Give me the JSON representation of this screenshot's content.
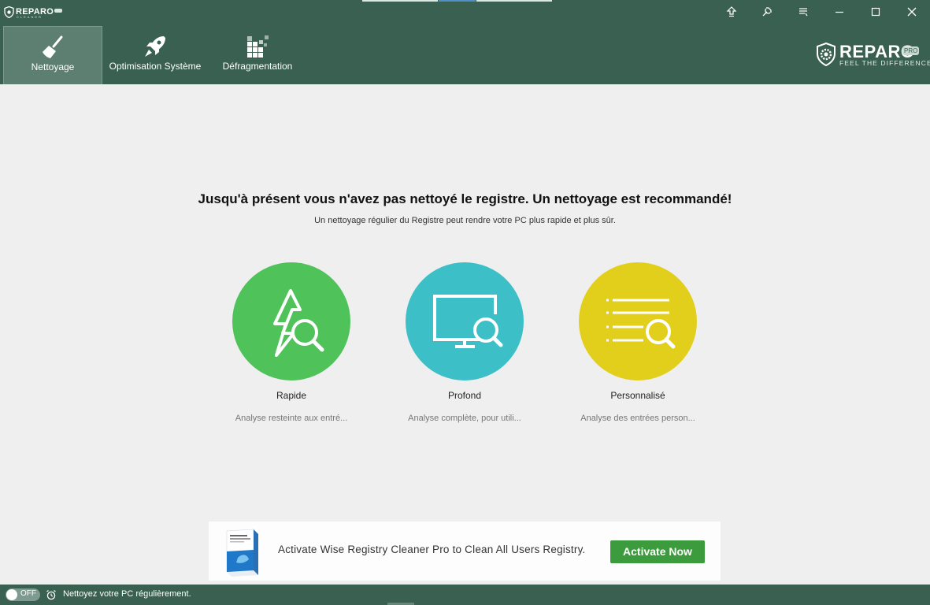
{
  "app": {
    "logo_text": "REPARO",
    "logo_sub": "CLEANER"
  },
  "title_bar": {
    "controls": [
      {
        "name": "upgrade-icon"
      },
      {
        "name": "tools-icon"
      },
      {
        "name": "menu-icon"
      },
      {
        "name": "minimize-icon"
      },
      {
        "name": "maximize-icon"
      },
      {
        "name": "close-icon"
      }
    ]
  },
  "tabs": [
    {
      "label": "Nettoyage",
      "icon": "broom-icon",
      "active": true
    },
    {
      "label": "Optimisation Système",
      "icon": "rocket-icon",
      "active": false
    },
    {
      "label": "Défragmentation",
      "icon": "blocks-icon",
      "active": false
    }
  ],
  "brand": {
    "name": "REPARO",
    "badge": "PRO",
    "tagline": "FEEL THE DIFFERENCE"
  },
  "main": {
    "headline": "Jusqu'à présent vous n'avez pas nettoyé le registre. Un nettoyage est recommandé!",
    "subline": "Un nettoyage régulier du Registre peut rendre votre PC plus rapide et plus sûr.",
    "modes": [
      {
        "name": "Rapide",
        "description": "Analyse resteinte aux entré...",
        "color": "#4fc25a",
        "icon": "lightning-search-icon"
      },
      {
        "name": "Profond",
        "description": "Analyse complète, pour utili...",
        "color": "#3cbfc6",
        "icon": "monitor-search-icon"
      },
      {
        "name": "Personnalisé",
        "description": "Analyse des entrées person...",
        "color": "#e2cf1b",
        "icon": "list-search-icon"
      }
    ]
  },
  "banner": {
    "text": "Activate Wise Registry Cleaner Pro to Clean All Users Registry.",
    "button": "Activate Now",
    "button_color": "#3c9b3c"
  },
  "status": {
    "toggle": "OFF",
    "text": "Nettoyez votre PC régulièrement."
  },
  "colors": {
    "header": "#3a6052",
    "active_tab": "#5d7f72",
    "background": "#efefef"
  }
}
